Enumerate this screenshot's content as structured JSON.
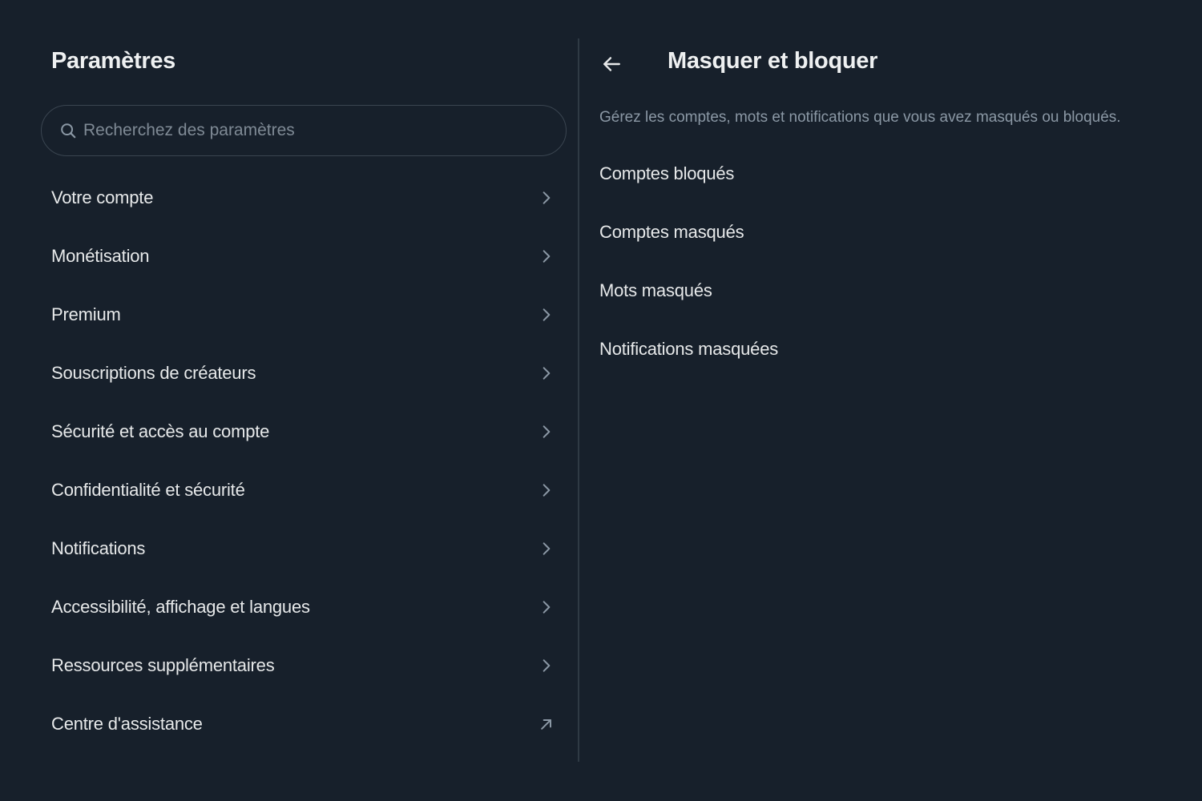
{
  "settings": {
    "title": "Paramètres",
    "search": {
      "placeholder": "Recherchez des paramètres",
      "value": "",
      "icon": "search-icon"
    },
    "menu": [
      {
        "label": "Votre compte",
        "icon": "chevron-right-icon"
      },
      {
        "label": "Monétisation",
        "icon": "chevron-right-icon"
      },
      {
        "label": "Premium",
        "icon": "chevron-right-icon"
      },
      {
        "label": "Souscriptions de créateurs",
        "icon": "chevron-right-icon"
      },
      {
        "label": "Sécurité et accès au compte",
        "icon": "chevron-right-icon"
      },
      {
        "label": "Confidentialité et sécurité",
        "icon": "chevron-right-icon"
      },
      {
        "label": "Notifications",
        "icon": "chevron-right-icon"
      },
      {
        "label": "Accessibilité, affichage et langues",
        "icon": "chevron-right-icon"
      },
      {
        "label": "Ressources supplémentaires",
        "icon": "chevron-right-icon"
      },
      {
        "label": "Centre d'assistance",
        "icon": "external-link-arrow-icon"
      }
    ]
  },
  "panel": {
    "back_icon": "arrow-left-icon",
    "title": "Masquer et bloquer",
    "description": "Gérez les comptes, mots et notifications que vous avez masqués ou bloqués.",
    "options": [
      {
        "label": "Comptes bloqués"
      },
      {
        "label": "Comptes masqués"
      },
      {
        "label": "Mots masqués"
      },
      {
        "label": "Notifications masquées"
      }
    ]
  },
  "colors": {
    "background": "#17202b",
    "text_primary": "#e7e9ea",
    "text_secondary": "#8b98a5",
    "border": "#3a4550"
  }
}
